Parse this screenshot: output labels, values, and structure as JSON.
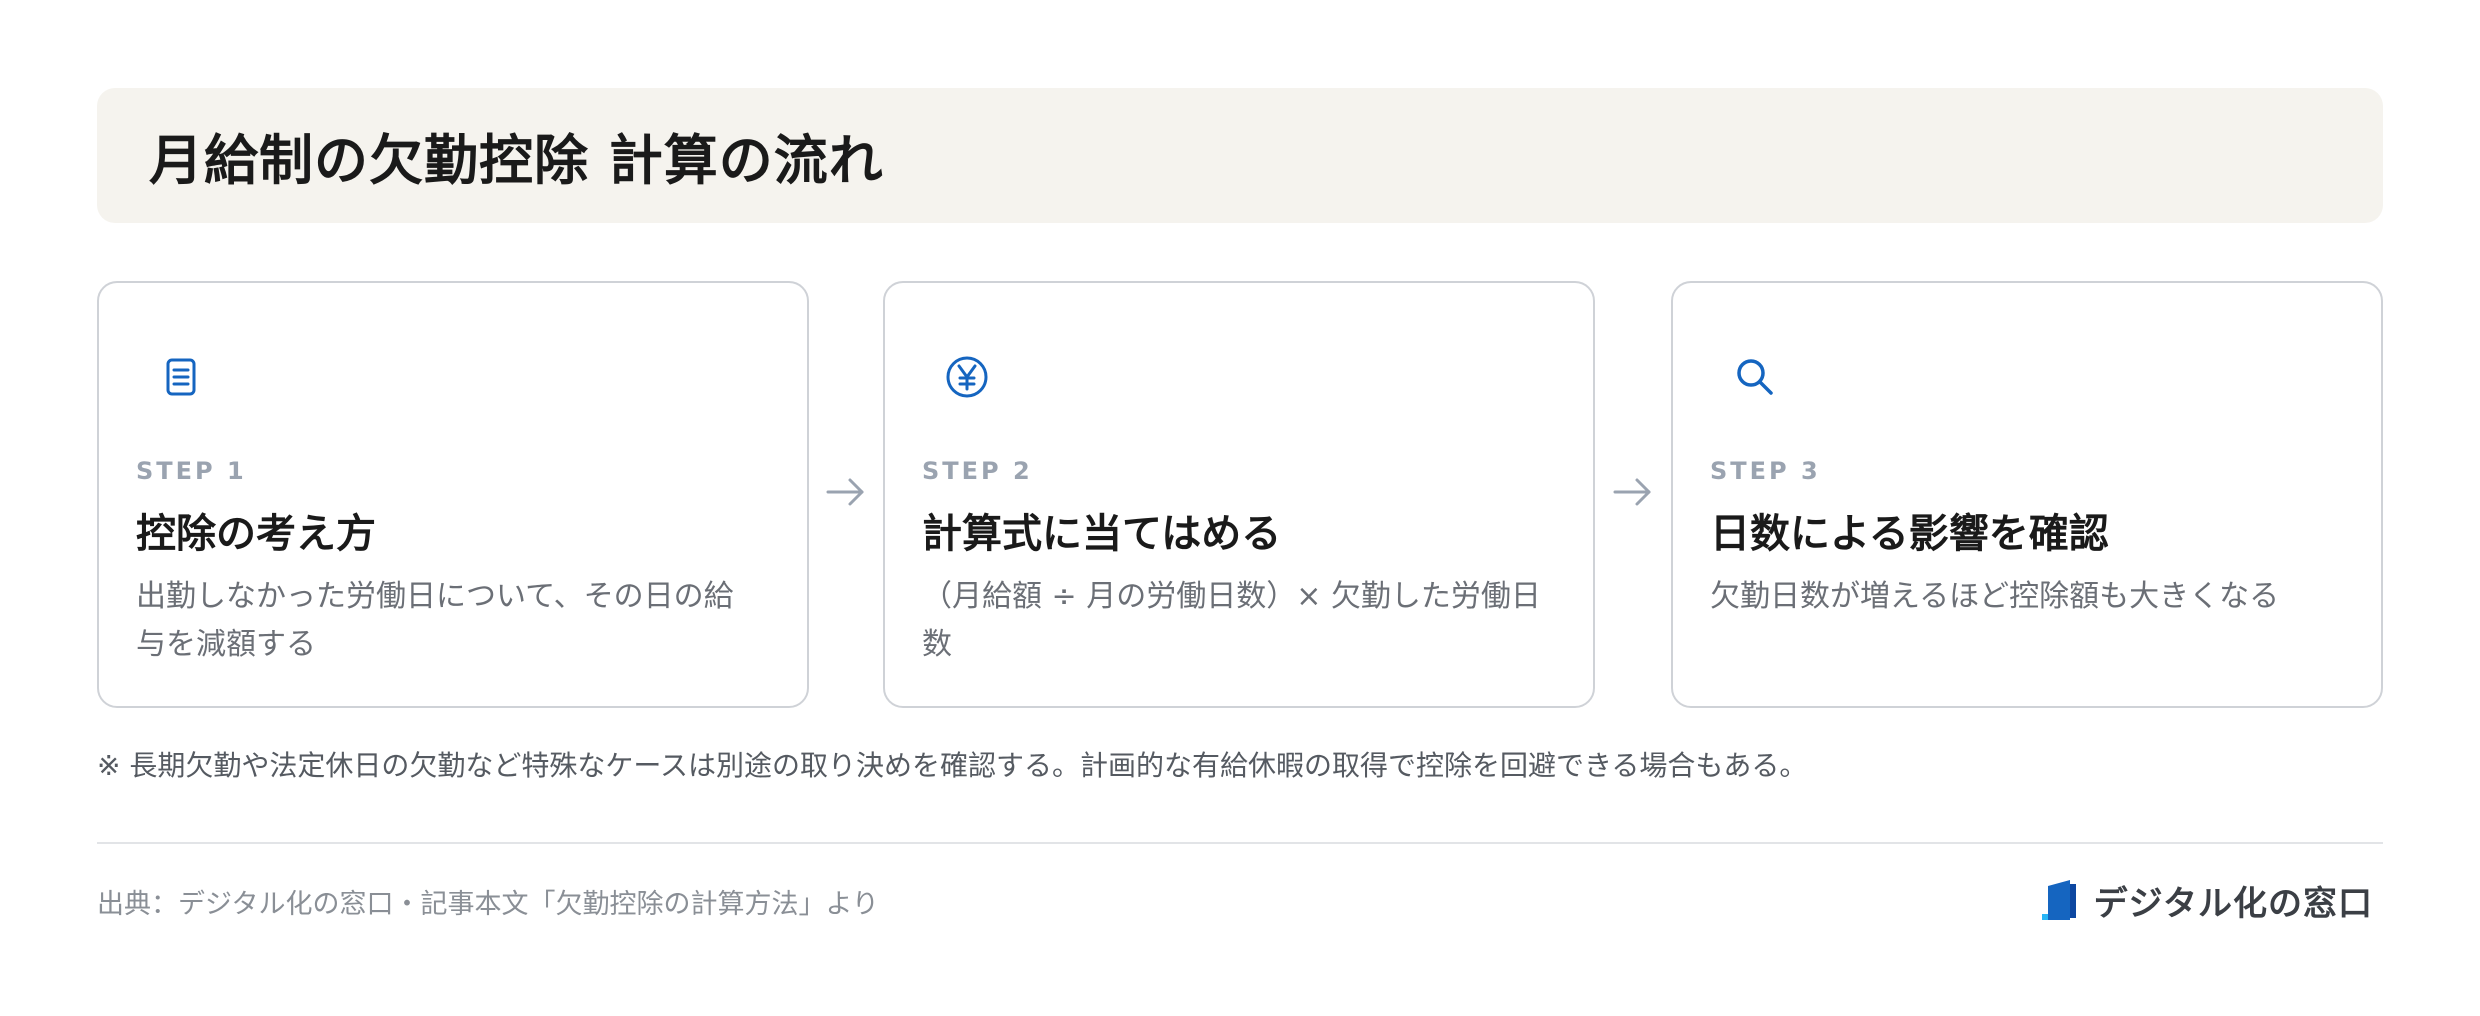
{
  "header": {
    "title": "月給制の欠勤控除 計算の流れ"
  },
  "steps": [
    {
      "step_label": "STEP 1",
      "title": "控除の考え方",
      "description": "出勤しなかった労働日について、その日の給与を減額する",
      "icon": "document-icon"
    },
    {
      "step_label": "STEP 2",
      "title": "計算式に当てはめる",
      "description": "（月給額 ÷ 月の労働日数）× 欠勤した労働日数",
      "icon": "yen-icon"
    },
    {
      "step_label": "STEP 3",
      "title": "日数による影響を確認",
      "description": "欠勤日数が増えるほど控除額も大きくなる",
      "icon": "search-icon"
    }
  ],
  "note": "※ 長期欠勤や法定休日の欠勤など特殊なケースは別途の取り決めを確認する。計画的な有給休暇の取得で控除を回避できる場合もある。",
  "footer": {
    "source": "出典：デジタル化の窓口・記事本文「欠勤控除の計算方法」より",
    "brand_name": "デジタル化の窓口"
  },
  "colors": {
    "accent": "#1565c0",
    "title_bg": "#f5f3ee",
    "card_border": "#cfd2d7",
    "step_label": "#9aa3b0",
    "arrow": "#9aa3b0"
  }
}
